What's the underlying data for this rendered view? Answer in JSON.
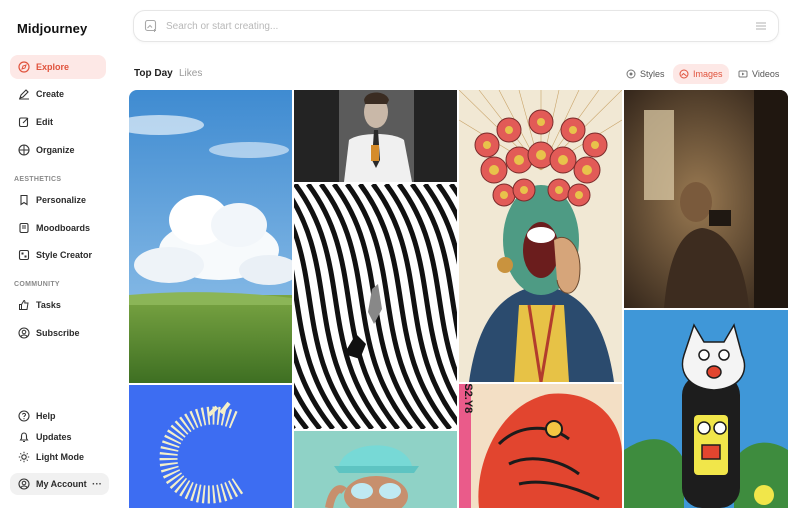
{
  "app": {
    "title": "Midjourney"
  },
  "sidebar": {
    "main": [
      {
        "label": "Explore",
        "icon": "compass-icon",
        "active": true
      },
      {
        "label": "Create",
        "icon": "pencil-icon"
      },
      {
        "label": "Edit",
        "icon": "edit-icon"
      },
      {
        "label": "Organize",
        "icon": "grid-icon"
      }
    ],
    "aesthetics_label": "AESTHETICS",
    "aesthetics": [
      {
        "label": "Personalize",
        "icon": "bookmark-icon"
      },
      {
        "label": "Moodboards",
        "icon": "moodboard-icon"
      },
      {
        "label": "Style Creator",
        "icon": "palette-icon"
      }
    ],
    "community_label": "COMMUNITY",
    "community": [
      {
        "label": "Tasks",
        "icon": "thumbs-up-icon"
      },
      {
        "label": "Subscribe",
        "icon": "subscribe-icon"
      }
    ],
    "bottom": [
      {
        "label": "Help",
        "icon": "help-icon"
      },
      {
        "label": "Updates",
        "icon": "bell-icon"
      },
      {
        "label": "Light Mode",
        "icon": "sun-icon"
      }
    ],
    "account": {
      "label": "My Account",
      "more": "···"
    }
  },
  "search": {
    "placeholder": "Search or start creating..."
  },
  "tabs": {
    "top_day": "Top Day",
    "likes": "Likes"
  },
  "filters": [
    {
      "label": "Styles",
      "icon": "styles-icon"
    },
    {
      "label": "Images",
      "icon": "image-icon",
      "active": true
    },
    {
      "label": "Videos",
      "icon": "video-icon"
    }
  ],
  "colors": {
    "accent": "#e0533d",
    "accent_bg": "#fde8e6"
  },
  "gallery": {
    "tiles": [
      {
        "name": "sky-meadow-image"
      },
      {
        "name": "portrait-man-drink-image"
      },
      {
        "name": "masked-figure-illustration"
      },
      {
        "name": "selfie-mirror-photo"
      },
      {
        "name": "op-art-stripes-image"
      },
      {
        "name": "blue-abstract-letter-image"
      },
      {
        "name": "cyan-cap-portrait-image"
      },
      {
        "name": "red-beast-poster-image"
      },
      {
        "name": "cat-monster-illustration"
      }
    ],
    "poster_text": "SS2.Y8"
  }
}
